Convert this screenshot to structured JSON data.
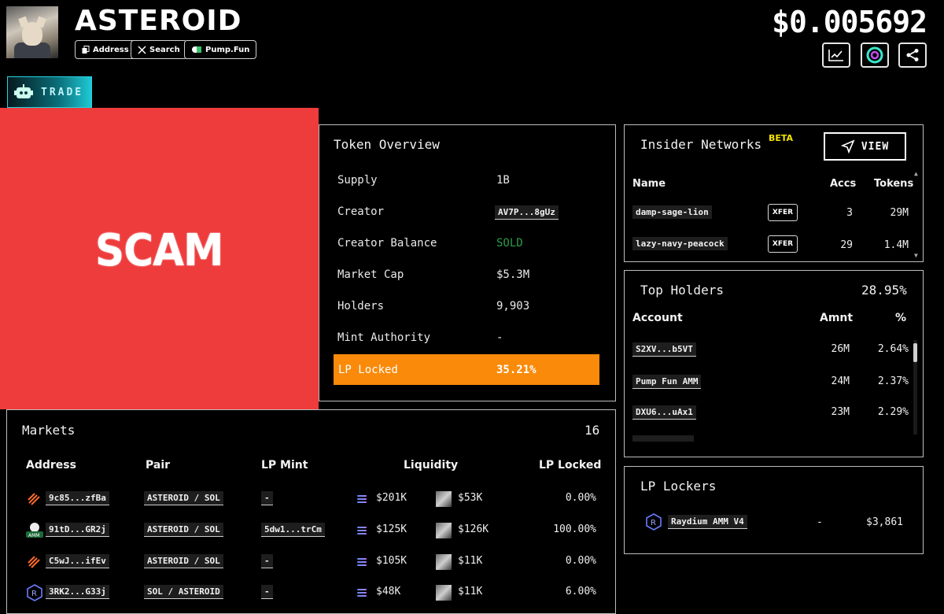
{
  "header": {
    "title": "ASTEROID",
    "price": "$0.005692",
    "links": [
      {
        "label": "Address",
        "icon": "copy-icon"
      },
      {
        "label": "Search",
        "icon": "x-logo-icon"
      },
      {
        "label": "Pump.Fun",
        "icon": "pill-icon"
      }
    ],
    "actions": [
      "chart-icon",
      "scanner-icon",
      "share-icon"
    ]
  },
  "trade_tab": {
    "label": "TRADE",
    "icon": "robot-icon"
  },
  "overlay": {
    "label": "SCAM",
    "color": "#ee3b3b"
  },
  "token_overview": {
    "title": "Token Overview",
    "rows": [
      {
        "label": "Supply",
        "value": "1B"
      },
      {
        "label": "Creator",
        "value": "AV7P...8gUz"
      },
      {
        "label": "Creator Balance",
        "value": "SOLD"
      },
      {
        "label": "Market Cap",
        "value": "$5.3M"
      },
      {
        "label": "Holders",
        "value": "9,903"
      },
      {
        "label": "Mint Authority",
        "value": "-"
      },
      {
        "label": "LP Locked",
        "value": "35.21%"
      }
    ],
    "sold_color": "#2e9c4a",
    "highlight_color": "#fa8a0a"
  },
  "insider_networks": {
    "title": "Insider Networks",
    "badge": "BETA",
    "view_label": "VIEW",
    "columns": [
      "Name",
      "Accs",
      "Tokens"
    ],
    "rows": [
      {
        "name": "damp-sage-lion",
        "tag": "XFER",
        "accs": "3",
        "tokens": "29M"
      },
      {
        "name": "lazy-navy-peacock",
        "tag": "XFER",
        "accs": "29",
        "tokens": "1.4M"
      }
    ]
  },
  "top_holders": {
    "title": "Top Holders",
    "total": "28.95%",
    "columns": [
      "Account",
      "Amnt",
      "%"
    ],
    "rows": [
      {
        "account": "S2XV...b5VT",
        "amount": "26M",
        "pct": "2.64%"
      },
      {
        "account": "Pump Fun AMM",
        "amount": "24M",
        "pct": "2.37%"
      },
      {
        "account": "DXU6...uAx1",
        "amount": "23M",
        "pct": "2.29%"
      }
    ]
  },
  "markets": {
    "title": "Markets",
    "count": "16",
    "columns": [
      "Address",
      "Pair",
      "LP Mint",
      "Liquidity",
      "LP Locked"
    ],
    "rows": [
      {
        "icon": "pumpswap-icon",
        "address": "9c85...zfBa",
        "base": "ASTEROID",
        "quote": "SOL",
        "lp_mint": "-",
        "liq_sol": "$201K",
        "liq_token": "$53K",
        "lp_locked": "0.00%"
      },
      {
        "icon": "amm-icon",
        "address": "91tD...GR2j",
        "base": "ASTEROID",
        "quote": "SOL",
        "lp_mint": "5dw1...trCm",
        "liq_sol": "$125K",
        "liq_token": "$126K",
        "lp_locked": "100.00%"
      },
      {
        "icon": "pumpswap-icon",
        "address": "C5wJ...ifEv",
        "base": "ASTEROID",
        "quote": "SOL",
        "lp_mint": "-",
        "liq_sol": "$105K",
        "liq_token": "$11K",
        "lp_locked": "0.00%"
      },
      {
        "icon": "raydium-icon",
        "address": "3RK2...G33j",
        "base": "SOL",
        "quote": "ASTEROID",
        "lp_mint": "-",
        "liq_sol": "$48K",
        "liq_token": "$11K",
        "lp_locked": "6.00%"
      }
    ]
  },
  "lp_lockers": {
    "title": "LP Lockers",
    "rows": [
      {
        "icon": "raydium-icon",
        "name": "Raydium AMM V4",
        "dash": "-",
        "value": "$3,861"
      }
    ]
  }
}
